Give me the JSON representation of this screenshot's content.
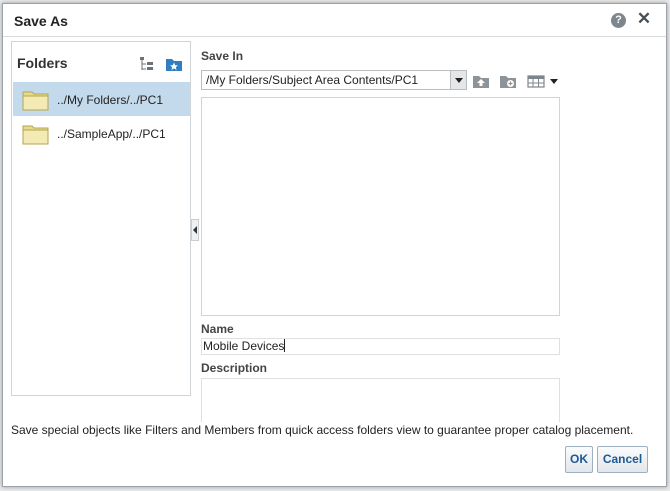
{
  "dialog": {
    "title": "Save As",
    "help_glyph": "?",
    "close_glyph": "✕"
  },
  "folders": {
    "title": "Folders",
    "items": [
      {
        "label": "../My Folders/../PC1",
        "selected": true
      },
      {
        "label": "../SampleApp/../PC1",
        "selected": false
      }
    ]
  },
  "save_in": {
    "label": "Save In",
    "path": "/My Folders/Subject Area Contents/PC1",
    "toolbar_icons": [
      "folder-up-icon",
      "new-folder-icon",
      "view-options-icon"
    ]
  },
  "name": {
    "label": "Name",
    "value": "Mobile Devices"
  },
  "description": {
    "label": "Description",
    "value": ""
  },
  "hint": "Save special objects like Filters and Members from quick access folders view to guarantee proper catalog placement.",
  "buttons": {
    "ok": "OK",
    "cancel": "Cancel"
  },
  "colors": {
    "selected_row": "#c3d9ec",
    "button_text": "#1d5a93",
    "folder_fill": "#f1eab0"
  }
}
